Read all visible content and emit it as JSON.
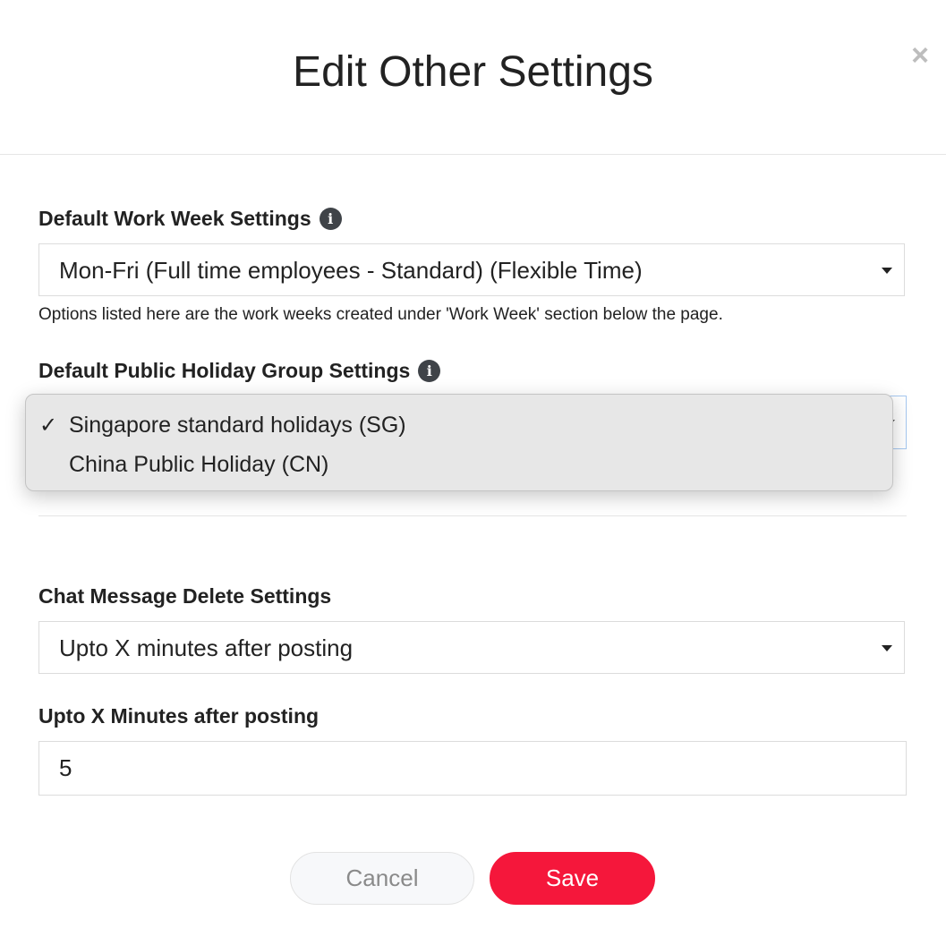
{
  "modal": {
    "title": "Edit Other Settings",
    "close_symbol": "×"
  },
  "work_week": {
    "label": "Default Work Week Settings",
    "info_icon": "i",
    "selected": "Mon-Fri (Full time employees - Standard) (Flexible Time)",
    "help_text": "Options listed here are the work weeks created under 'Work Week' section below the page."
  },
  "public_holiday": {
    "label": "Default Public Holiday Group Settings",
    "info_icon": "i",
    "options": [
      {
        "label": "Singapore standard holidays (SG)",
        "checked": "✓"
      },
      {
        "label": "China Public Holiday (CN)",
        "checked": ""
      }
    ]
  },
  "chat_delete": {
    "label": "Chat Message Delete Settings",
    "selected": "Upto X minutes after posting"
  },
  "minutes": {
    "label": "Upto X Minutes after posting",
    "value": "5"
  },
  "footer": {
    "cancel_label": "Cancel",
    "save_label": "Save"
  },
  "colors": {
    "save_button": "#f5173b",
    "info_icon": "#3f4348",
    "dropdown_bg": "#e7e7e7"
  }
}
